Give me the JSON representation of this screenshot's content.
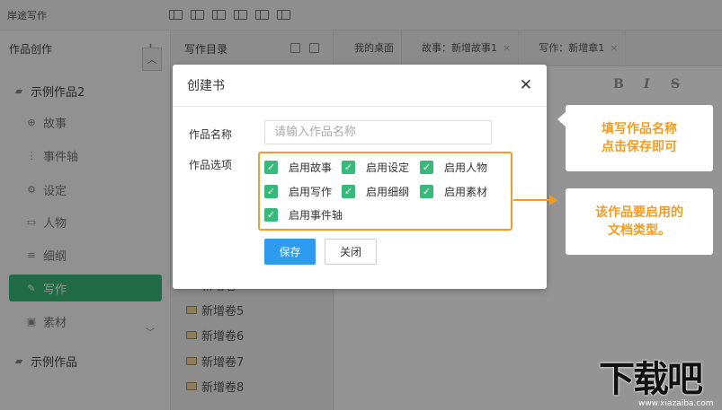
{
  "app": {
    "title": "岸途写作"
  },
  "sidebar": {
    "header": "作品创作",
    "add_icon": "plus-icon",
    "items": [
      {
        "label": "示例作品2",
        "icon": "book-icon"
      },
      {
        "label": "故事",
        "icon": "globe-icon"
      },
      {
        "label": "事件轴",
        "icon": "timeline-icon"
      },
      {
        "label": "设定",
        "icon": "gear-icon"
      },
      {
        "label": "人物",
        "icon": "person-card-icon"
      },
      {
        "label": "细纲",
        "icon": "list-icon"
      },
      {
        "label": "写作",
        "icon": "pen-icon"
      },
      {
        "label": "素材",
        "icon": "image-icon"
      },
      {
        "label": "示例作品",
        "icon": "book-icon"
      }
    ]
  },
  "catalog": {
    "header": "写作目录",
    "volumes": [
      "新增卷5",
      "新增卷6",
      "新增卷7",
      "新增卷8"
    ],
    "partial_volume": "新增卷"
  },
  "tabs": [
    {
      "label": "我的桌面",
      "closable": false
    },
    {
      "label": "故事：新增故事1",
      "closable": true
    },
    {
      "label": "写作：新增章1",
      "closable": true
    }
  ],
  "editor": {
    "format_buttons": [
      "B",
      "I",
      "S"
    ]
  },
  "dialog": {
    "title": "创建书",
    "name_label": "作品名称",
    "name_placeholder": "请输入作品名称",
    "options_label": "作品选项",
    "options": [
      {
        "label": "启用故事",
        "checked": true
      },
      {
        "label": "启用设定",
        "checked": true
      },
      {
        "label": "启用人物",
        "checked": true
      },
      {
        "label": "启用写作",
        "checked": true
      },
      {
        "label": "启用细纲",
        "checked": true
      },
      {
        "label": "启用素材",
        "checked": true
      },
      {
        "label": "启用事件轴",
        "checked": true
      }
    ],
    "save_label": "保存",
    "close_label": "关闭"
  },
  "callouts": {
    "first": {
      "line1": "填写作品名称",
      "line2": "点击保存即可"
    },
    "second": {
      "line1": "该作品要启用的",
      "line2": "文档类型。"
    }
  },
  "watermark": {
    "text": "下载吧",
    "url": "www.xiazaiba.com"
  },
  "colors": {
    "accent_green": "#39b979",
    "primary_blue": "#2d9cf0",
    "highlight_orange": "#f39c1f"
  }
}
